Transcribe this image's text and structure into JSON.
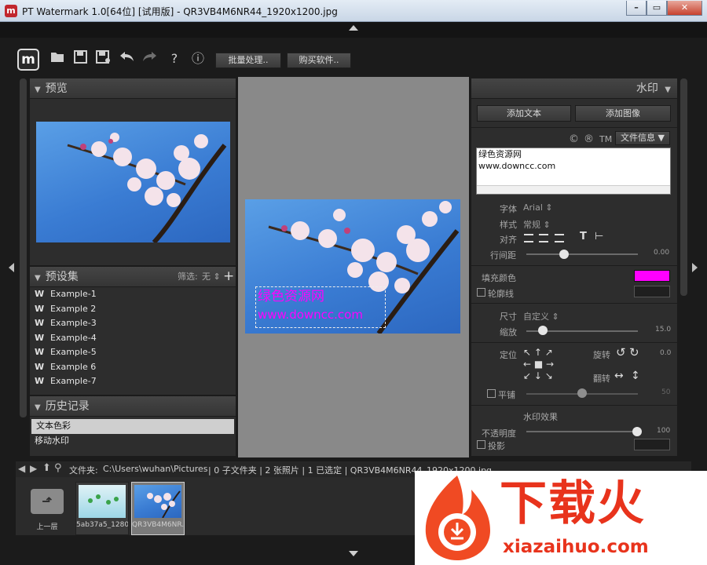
{
  "window": {
    "title": "PT Watermark 1.0[64位] [试用版] - QR3VB4M6NR44_1920x1200.jpg",
    "app_icon": "m",
    "controls": [
      "–",
      "▭",
      "✕"
    ]
  },
  "toolbar": {
    "logo": "m",
    "icons": [
      "folder-icon",
      "save-icon",
      "save-as-icon",
      "undo-icon",
      "redo-icon",
      "help-icon",
      "info-icon"
    ],
    "help_glyph": "?",
    "info_glyph": "ⓘ",
    "batch_label": "批量处理..",
    "buy_label": "购买软件.."
  },
  "preview": {
    "title": "预览"
  },
  "presets": {
    "title": "预设集",
    "filter_label": "筛选:",
    "filter_value": "无",
    "items": [
      "Example-1",
      "Example 2",
      "Example-3",
      "Example-4",
      "Example-5",
      "Example 6",
      "Example-7"
    ]
  },
  "history": {
    "title": "历史记录",
    "items": [
      "文本色彩",
      "移动水印"
    ]
  },
  "canvas": {
    "watermark_lines": [
      "绿色资源网",
      "www.downcc.com"
    ]
  },
  "right_panel": {
    "title": "水印",
    "add_text": "添加文本",
    "add_image": "添加图像",
    "symbols": [
      "©",
      "®",
      "TM"
    ],
    "file_info": "文件信息",
    "text_lines": [
      "绿色资源网",
      "www.downcc.com"
    ],
    "font_label": "字体",
    "font_value": "Arial",
    "style_label": "样式",
    "style_value": "常规",
    "align_label": "对齐",
    "linespace_label": "行间距",
    "linespace_value": "0.00",
    "fill_label": "填充颜色",
    "fill_color": "#ff00ff",
    "outline_label": "轮廓线",
    "size_label": "尺寸",
    "size_value": "自定义",
    "scale_label": "缩放",
    "scale_value": "15.0",
    "position_label": "定位",
    "rotate_label": "旋转",
    "rotate_value": "0.0",
    "flip_label": "翻转",
    "tile_label": "平铺",
    "tile_value": "50",
    "effects_title": "水印效果",
    "opacity_label": "不透明度",
    "opacity_value": "100",
    "shadow_label": "投影"
  },
  "statusbar": {
    "folder_label": "文件夹:",
    "path": "C:\\Users\\wuhan\\Pictures",
    "info": "| 0 子文件夹 | 2 张照片 | 1 已选定 | QR3VB4M6NR44_1920x1200.jpg"
  },
  "filmstrip": {
    "items": [
      {
        "label": "上一层"
      },
      {
        "label": "5ab37a5_1280..."
      },
      {
        "label": "QR3VB4M6NR..."
      }
    ]
  },
  "ad": {
    "brand": "下载火",
    "url": "xiazaihuo.com"
  }
}
